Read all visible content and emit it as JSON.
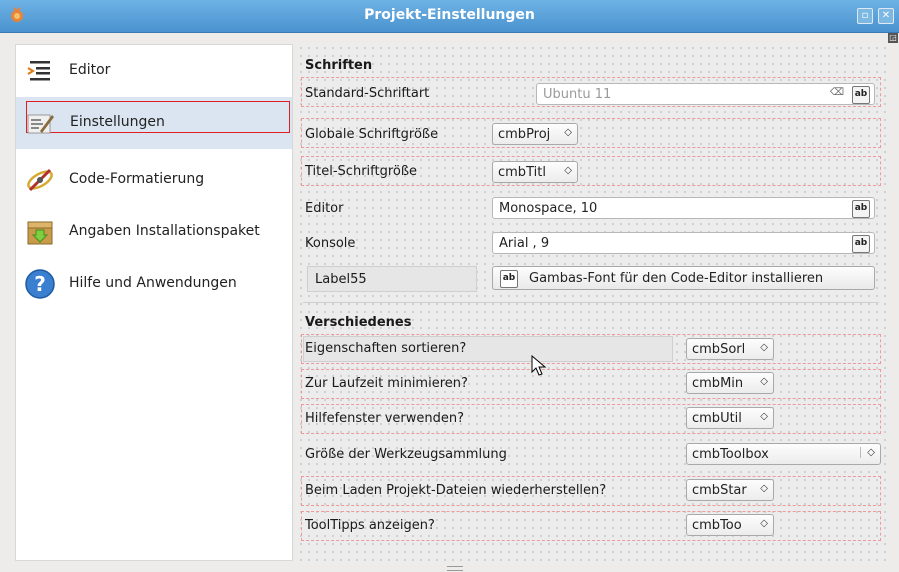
{
  "window": {
    "title": "Projekt-Einstellungen"
  },
  "colors": {
    "titlebar": "#4a93cf",
    "selection": "#dbe5f2",
    "red_frame": "#e02020"
  },
  "sidebar": {
    "items": [
      {
        "label": "Editor",
        "icon": "editor-icon"
      },
      {
        "label": "Einstellungen",
        "icon": "settings-icon",
        "selected": true
      },
      {
        "label": "Code-Formatierung",
        "icon": "code-format-icon"
      },
      {
        "label": "Angaben Installationspaket",
        "icon": "package-icon"
      },
      {
        "label": "Hilfe und Anwendungen",
        "icon": "help-icon"
      }
    ]
  },
  "fonts": {
    "heading": "Schriften",
    "standard_label": "Standard-Schriftart",
    "standard_placeholder": "Ubuntu 11",
    "global_size_label": "Globale Schriftgröße",
    "global_size_combo": "cmbProj",
    "title_size_label": "Titel-Schriftgröße",
    "title_size_combo": "cmbTitl",
    "editor_label": "Editor",
    "editor_value": "Monospace, 10",
    "console_label": "Konsole",
    "console_value": "Arial , 9",
    "label55": "Label55",
    "install_button": "Gambas-Font für den Code-Editor installieren"
  },
  "misc": {
    "heading": "Verschiedenes",
    "rows": [
      {
        "label": "Eigenschaften sortieren?",
        "combo": "cmbSorl"
      },
      {
        "label": "Zur Laufzeit minimieren?",
        "combo": "cmbMin"
      },
      {
        "label": "Hilfefenster verwenden?",
        "combo": "cmbUtil"
      },
      {
        "label": "Größe der Werkzeugsammlung",
        "combo": "cmbToolbox"
      },
      {
        "label": "Beim Laden Projekt-Dateien wiederherstellen?",
        "combo": "cmbStar"
      },
      {
        "label": "ToolTipps anzeigen?",
        "combo": "cmbToo"
      }
    ]
  }
}
